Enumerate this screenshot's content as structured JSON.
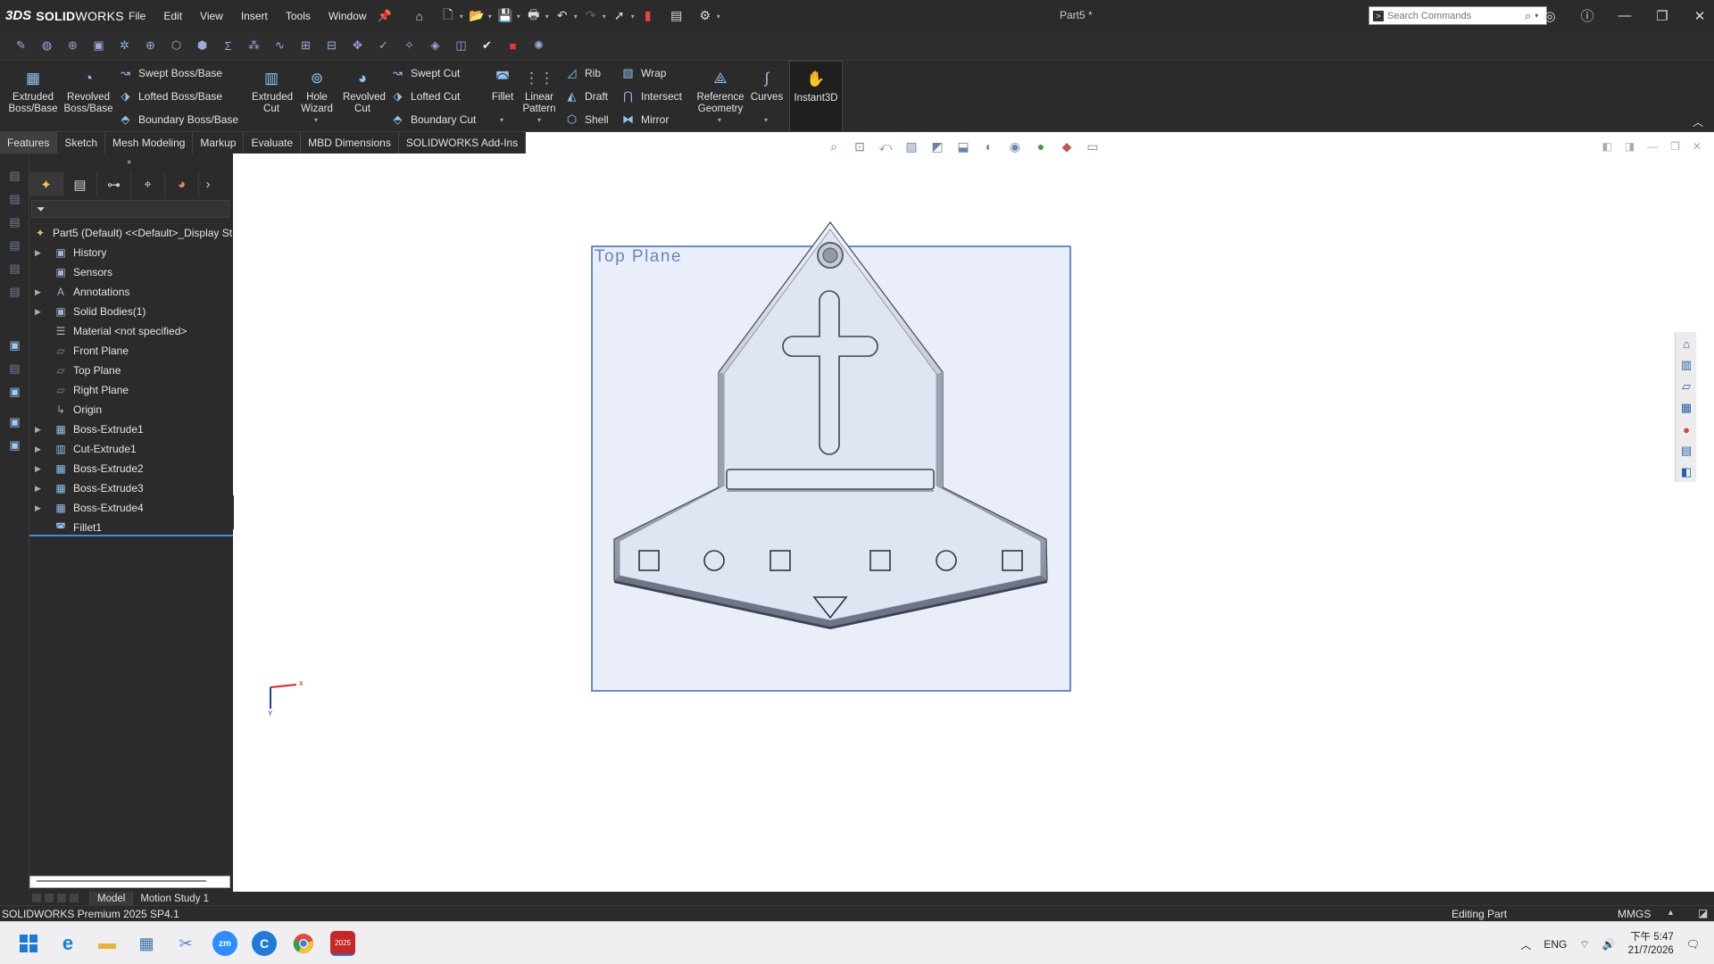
{
  "app": {
    "logo_ds": "3DS",
    "logo_text_bold": "SOLID",
    "logo_text_light": "WORKS",
    "document_title": "Part5 *"
  },
  "menu": [
    "File",
    "Edit",
    "View",
    "Insert",
    "Tools",
    "Window"
  ],
  "search": {
    "placeholder": "Search Commands"
  },
  "ribbon": {
    "extruded_boss": "Extruded Boss/Base",
    "revolved_boss": "Revolved Boss/Base",
    "swept_boss": "Swept Boss/Base",
    "lofted_boss": "Lofted Boss/Base",
    "boundary_boss": "Boundary Boss/Base",
    "extruded_cut": "Extruded Cut",
    "hole_wizard": "Hole Wizard",
    "revolved_cut": "Revolved Cut",
    "swept_cut": "Swept Cut",
    "lofted_cut": "Lofted Cut",
    "boundary_cut": "Boundary Cut",
    "fillet": "Fillet",
    "linear_pattern": "Linear Pattern",
    "rib": "Rib",
    "draft": "Draft",
    "shell": "Shell",
    "wrap": "Wrap",
    "intersect": "Intersect",
    "mirror": "Mirror",
    "reference_geometry": "Reference Geometry",
    "curves": "Curves",
    "instant3d": "Instant3D"
  },
  "tabs": [
    "Features",
    "Sketch",
    "Mesh Modeling",
    "Markup",
    "Evaluate",
    "MBD Dimensions",
    "SOLIDWORKS Add-Ins"
  ],
  "feature_tree": {
    "root": "Part5 (Default) <<Default>_Display St",
    "nodes": [
      {
        "label": "History",
        "expandable": true,
        "icon": "history-folder-icon"
      },
      {
        "label": "Sensors",
        "expandable": false,
        "icon": "sensors-folder-icon"
      },
      {
        "label": "Annotations",
        "expandable": true,
        "icon": "annotations-icon"
      },
      {
        "label": "Solid Bodies(1)",
        "expandable": true,
        "icon": "solid-bodies-icon"
      },
      {
        "label": "Material <not specified>",
        "expandable": false,
        "icon": "material-icon"
      },
      {
        "label": "Front Plane",
        "expandable": false,
        "icon": "plane-icon"
      },
      {
        "label": "Top Plane",
        "expandable": false,
        "icon": "plane-icon"
      },
      {
        "label": "Right Plane",
        "expandable": false,
        "icon": "plane-icon"
      },
      {
        "label": "Origin",
        "expandable": false,
        "icon": "origin-icon"
      },
      {
        "label": "Boss-Extrude1",
        "expandable": true,
        "icon": "boss-extrude-icon"
      },
      {
        "label": "Cut-Extrude1",
        "expandable": true,
        "icon": "cut-extrude-icon"
      },
      {
        "label": "Boss-Extrude2",
        "expandable": true,
        "icon": "boss-extrude-icon"
      },
      {
        "label": "Boss-Extrude3",
        "expandable": true,
        "icon": "boss-extrude-icon"
      },
      {
        "label": "Boss-Extrude4",
        "expandable": true,
        "icon": "boss-extrude-icon"
      },
      {
        "label": "Fillet1",
        "expandable": false,
        "icon": "fillet-icon"
      }
    ]
  },
  "viewport": {
    "plane_label": "Top Plane",
    "triad_x": "x",
    "triad_y": "Y"
  },
  "bottom_tabs": [
    "Model",
    "Motion Study 1"
  ],
  "status": {
    "product": "SOLIDWORKS Premium 2025 SP4.1",
    "mode": "Editing Part",
    "units": "MMGS"
  },
  "taskbar": {
    "lang": "ENG",
    "time": "下午 5:47",
    "date": "21/7/2026",
    "sw_badge": "2025"
  },
  "colors": {
    "chrome_dark": "#2b2b2b",
    "accent_blue": "#3b8fe0",
    "plane_fill": "#e9eef8",
    "plane_border": "#3a66c8",
    "part_fill": "#dfe5f2"
  }
}
